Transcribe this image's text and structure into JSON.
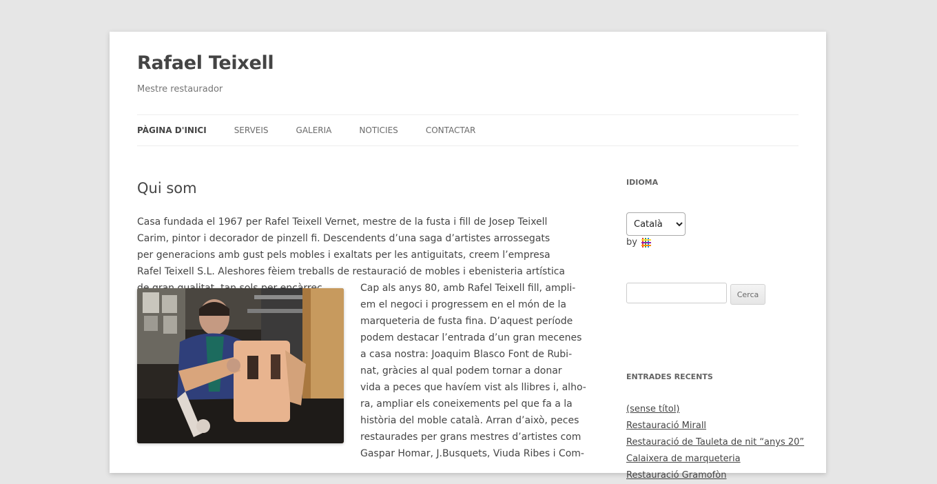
{
  "site": {
    "title": "Rafael Teixell",
    "description": "Mestre restaurador"
  },
  "nav": {
    "items": [
      {
        "label": "Pàgina d'inici",
        "current": true
      },
      {
        "label": "Serveis"
      },
      {
        "label": "Galeria"
      },
      {
        "label": "Noticies"
      },
      {
        "label": "Contactar"
      }
    ]
  },
  "article": {
    "title": "Qui som",
    "paragraph1": "Casa fundada el 1967 per Rafel Teixell Vernet, mestre de la fusta i fill de Josep Teixell Carim, pin­tor i decorador de pinzell fi. Descendents d’una saga d’artistes arrossegats per generacions amb gust pels mobles i exaltats per les antiguitats, creem l’empresa Rafel Teixell S.L. Aleshores fèiem treballs de restauració de mobles i ebenisteria artística de gran qualitat, tan sols per encàrrec.",
    "paragraph2_lines": [
      "Cap als anys 80, amb Rafel Teixell fill, ampli-",
      "em el negoci i progressem en el món de la",
      "marqueteria de fusta fina. D’aquest període",
      "podem destacar l’entrada d’un gran mecenes",
      "a casa nostra: Joaquim Blasco Font de Rubi-",
      "nat, gràcies al qual podem tornar a donar",
      "vida a peces que havíem vist als llibres i, alho-",
      "ra, ampliar els coneixements pel que fa a la",
      "història del moble català. Arran d’això, peces",
      "restaurades per grans mestres d’artistes com",
      "Gaspar Homar, J.Busquets, Viuda Ribes i Com-"
    ]
  },
  "sidebar": {
    "language_widget_title": "Idioma",
    "language_selected": "Català",
    "by_label": "by",
    "search_placeholder": "",
    "search_button": "Cerca",
    "recent_title": "Entrades recents",
    "recent_posts": [
      "(sense títol)",
      "Restauració Mirall",
      "Restauració de Tauleta de nit “anys 20”",
      "Calaixera de marqueteria",
      "Restauració Gramofòn"
    ]
  },
  "colors": {
    "background": "#e6e6e6",
    "page": "#ffffff",
    "text": "#444444"
  }
}
